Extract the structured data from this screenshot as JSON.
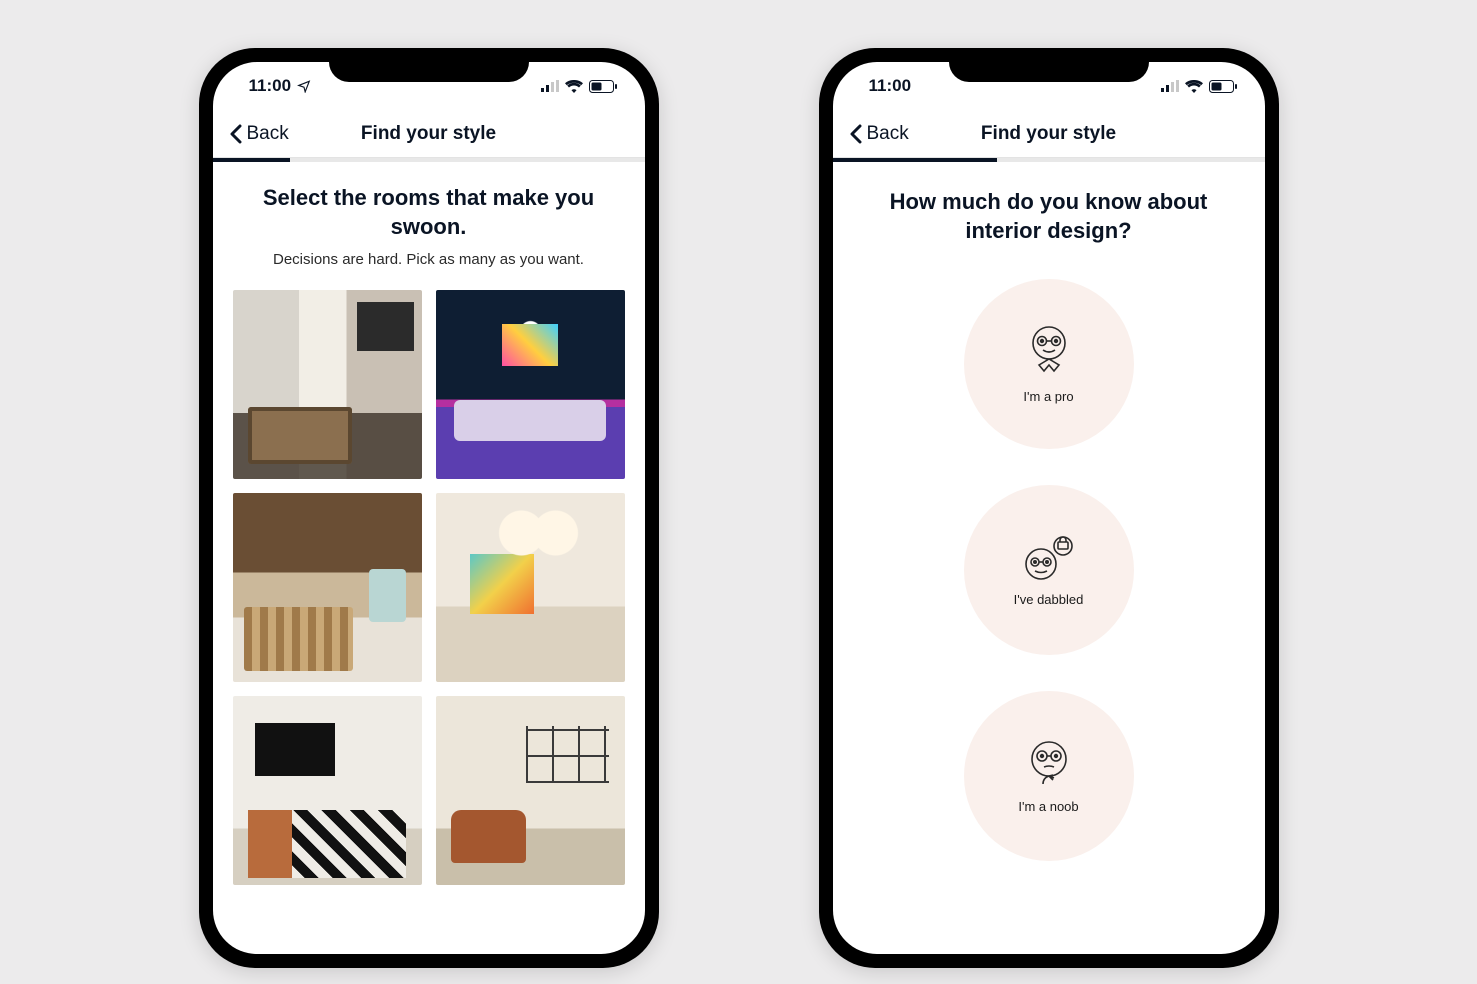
{
  "status": {
    "time": "11:00"
  },
  "nav": {
    "back_label": "Back",
    "title": "Find your style"
  },
  "phone1": {
    "progress_percent": 18,
    "heading": "Select the rooms that make you swoon.",
    "subheading": "Decisions are hard. Pick as many as you want.",
    "rooms": [
      {
        "name": "neutral-living-room"
      },
      {
        "name": "eclectic-colorful-room"
      },
      {
        "name": "rustic-wood-room"
      },
      {
        "name": "bright-pendant-room"
      },
      {
        "name": "modern-tv-room"
      },
      {
        "name": "leather-gallery-room"
      }
    ]
  },
  "phone2": {
    "progress_percent": 38,
    "heading": "How much do you know about interior design?",
    "options": [
      {
        "id": "pro",
        "label": "I'm a pro"
      },
      {
        "id": "dabbled",
        "label": "I've dabbled"
      },
      {
        "id": "noob",
        "label": "I'm a noob"
      }
    ]
  }
}
